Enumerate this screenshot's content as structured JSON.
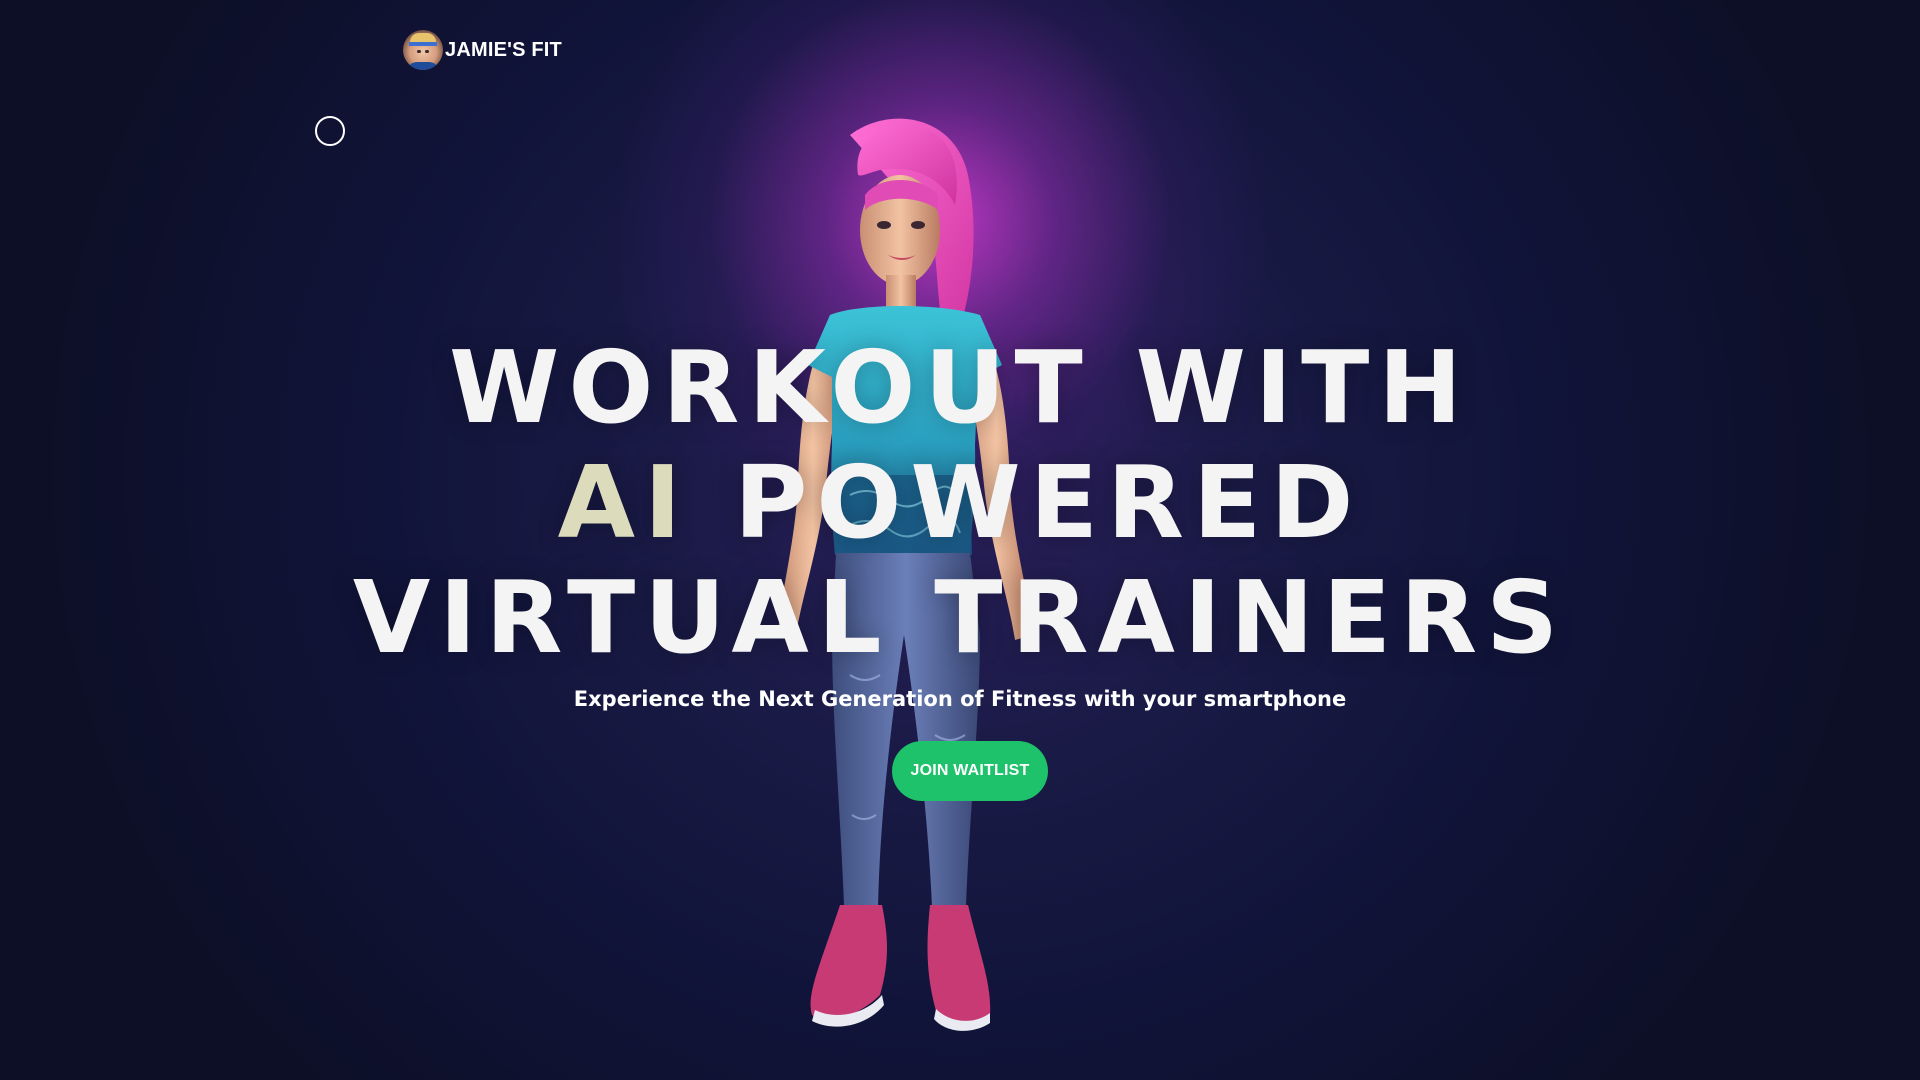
{
  "header": {
    "brand_name": "JAMIE'S FIT",
    "brand_avatar": "trainer-avatar",
    "menu_icon": "circle-icon"
  },
  "hero": {
    "title_line1": "WORKOUT WITH",
    "title_line2_accent": "AI",
    "title_line2_rest": "POWERED",
    "title_line3": "VIRTUAL TRAINERS",
    "subtitle": "Experience the Next Generation of Fitness with your smartphone",
    "cta_label": "JOIN WAITLIST"
  },
  "colors": {
    "background": "#0c0f25",
    "glow": "#d73cd7",
    "accent_text": "#dcdcbc",
    "cta": "#1dc26a",
    "text": "#ffffff"
  }
}
